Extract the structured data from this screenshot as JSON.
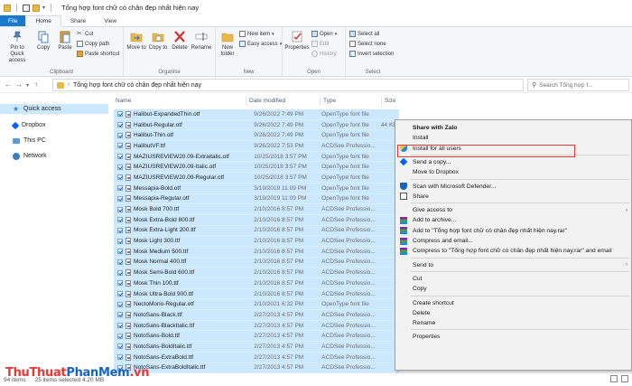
{
  "window": {
    "title": "Tổng hợp font chữ có chân đẹp nhất hiện nay"
  },
  "tabs": [
    {
      "label": "File"
    },
    {
      "label": "Home"
    },
    {
      "label": "Share"
    },
    {
      "label": "View"
    }
  ],
  "ribbon": {
    "clipboard": {
      "pin": "Pin to Quick access",
      "copy": "Copy",
      "paste": "Paste",
      "cut": "Cut",
      "copy_path": "Copy path",
      "paste_shortcut": "Paste shortcut",
      "label": "Clipboard"
    },
    "organise": {
      "move_to": "Move to",
      "copy_to": "Copy to",
      "delete": "Delete",
      "rename": "Rename",
      "label": "Organise"
    },
    "new": {
      "new_folder": "New folder",
      "new_item": "New item",
      "easy_access": "Easy access",
      "label": "New"
    },
    "open": {
      "properties": "Properties",
      "open": "Open",
      "edit": "Edit",
      "history": "History",
      "label": "Open"
    },
    "select": {
      "select_all": "Select all",
      "select_none": "Select none",
      "invert": "Invert selection",
      "label": "Select"
    }
  },
  "address": {
    "path": "Tổng hợp font chữ có chân đẹp nhất hiện nay",
    "search_placeholder": "Search Tổng hợp f..."
  },
  "nav_pane": [
    {
      "label": "Quick access",
      "icon": "star-icon"
    },
    {
      "label": "Dropbox",
      "icon": "dropbox-icon"
    },
    {
      "label": "This PC",
      "icon": "computer-icon"
    },
    {
      "label": "Network",
      "icon": "network-icon"
    }
  ],
  "columns": {
    "name": "Name",
    "date": "Date modified",
    "type": "Type",
    "size": "Size"
  },
  "files": [
    {
      "name": "Halibut-ExpandedThin.otf",
      "date": "9/26/2022 7:49 PM",
      "type": "OpenType font file",
      "size": ""
    },
    {
      "name": "Halibut-Regular.otf",
      "date": "9/26/2022 7:49 PM",
      "type": "OpenType font file",
      "size": "44 KB"
    },
    {
      "name": "Halibut-Thin.otf",
      "date": "9/26/2022 7:49 PM",
      "type": "OpenType font file",
      "size": ""
    },
    {
      "name": "HalibutVF.ttf",
      "date": "9/26/2022 7:53 PM",
      "type": "ACDSee Professio...",
      "size": ""
    },
    {
      "name": "MAZIUSREVIEW20.09-Extraitalic.otf",
      "date": "10/25/2018 3:57 PM",
      "type": "OpenType font file",
      "size": ""
    },
    {
      "name": "MAZIUSREVIEW20.09-Italic.otf",
      "date": "10/25/2018 3:57 PM",
      "type": "OpenType font file",
      "size": ""
    },
    {
      "name": "MAZIUSREVIEW20.09-Regular.otf",
      "date": "10/25/2018 3:57 PM",
      "type": "OpenType font file",
      "size": ""
    },
    {
      "name": "Messapia-Bold.otf",
      "date": "3/19/2019 11:09 PM",
      "type": "OpenType font file",
      "size": ""
    },
    {
      "name": "Messapia-Regular.otf",
      "date": "3/19/2019 11:09 PM",
      "type": "OpenType font file",
      "size": ""
    },
    {
      "name": "Mosk Bold 700.ttf",
      "date": "2/10/2016 8:57 PM",
      "type": "ACDSee Professio...",
      "size": ""
    },
    {
      "name": "Mosk Extra-Bold 800.ttf",
      "date": "2/10/2016 8:57 PM",
      "type": "ACDSee Professio...",
      "size": ""
    },
    {
      "name": "Mosk Extra-Light 200.ttf",
      "date": "2/10/2016 8:57 PM",
      "type": "ACDSee Professio...",
      "size": ""
    },
    {
      "name": "Mosk Light 300.ttf",
      "date": "2/10/2016 8:57 PM",
      "type": "ACDSee Professio...",
      "size": ""
    },
    {
      "name": "Mosk Medium 500.ttf",
      "date": "2/10/2016 8:57 PM",
      "type": "ACDSee Professio...",
      "size": ""
    },
    {
      "name": "Mosk Normal 400.ttf",
      "date": "2/10/2016 8:57 PM",
      "type": "ACDSee Professio...",
      "size": ""
    },
    {
      "name": "Mosk Semi-Bold 600.ttf",
      "date": "2/10/2016 8:57 PM",
      "type": "ACDSee Professio...",
      "size": ""
    },
    {
      "name": "Mosk Thin 100.ttf",
      "date": "2/10/2016 8:57 PM",
      "type": "ACDSee Professio...",
      "size": ""
    },
    {
      "name": "Mosk Ultra-Bold 900.ttf",
      "date": "2/10/2016 8:57 PM",
      "type": "ACDSee Professio...",
      "size": ""
    },
    {
      "name": "NectoMono-Regular.otf",
      "date": "2/10/2021 6:32 PM",
      "type": "OpenType font file",
      "size": ""
    },
    {
      "name": "NotoSans-Black.ttf",
      "date": "2/27/2013 4:57 PM",
      "type": "ACDSee Professio...",
      "size": ""
    },
    {
      "name": "NotoSans-BlackItalic.ttf",
      "date": "2/27/2013 4:57 PM",
      "type": "ACDSee Professio...",
      "size": ""
    },
    {
      "name": "NotoSans-Bold.ttf",
      "date": "2/27/2013 4:57 PM",
      "type": "ACDSee Professio...",
      "size": ""
    },
    {
      "name": "NotoSans-BoldItalic.ttf",
      "date": "2/27/2013 4:57 PM",
      "type": "ACDSee Professio...",
      "size": ""
    },
    {
      "name": "NotoSans-ExtraBold.ttf",
      "date": "2/27/2013 4:57 PM",
      "type": "ACDSee Professio...",
      "size": ""
    },
    {
      "name": "NotoSans-ExtraBoldItalic.ttf",
      "date": "2/27/2013 4:57 PM",
      "type": "ACDSee Professio...",
      "size": ""
    }
  ],
  "status": {
    "items": "94 items",
    "selected": "25 items selected  4.20 MB"
  },
  "context_menu": [
    {
      "label": "Share with Zalo",
      "bold": true,
      "icon": ""
    },
    {
      "label": "Install",
      "icon": ""
    },
    {
      "label": "Install for all users",
      "icon": "shield-icon"
    },
    {
      "sep": true
    },
    {
      "label": "Send a copy...",
      "icon": "dropbox-icon"
    },
    {
      "label": "Move to Dropbox",
      "icon": ""
    },
    {
      "sep": true
    },
    {
      "label": "Scan with Microsoft Defender...",
      "icon": "defender-icon"
    },
    {
      "label": "Share",
      "icon": "share-icon"
    },
    {
      "sep": true
    },
    {
      "label": "Give access to",
      "icon": "",
      "submenu": true
    },
    {
      "label": "Add to archive...",
      "icon": "winrar-icon"
    },
    {
      "label": "Add to \"Tổng hợp font chữ có chân đẹp nhất hiện nay.rar\"",
      "icon": "winrar-icon"
    },
    {
      "label": "Compress and email...",
      "icon": "winrar-icon"
    },
    {
      "label": "Compress to \"Tổng hợp font chữ có chân đẹp nhất hiện nay.rar\" and email",
      "icon": "winrar-icon"
    },
    {
      "sep": true
    },
    {
      "label": "Send to",
      "icon": "",
      "submenu": true
    },
    {
      "sep": true
    },
    {
      "label": "Cut",
      "icon": ""
    },
    {
      "label": "Copy",
      "icon": ""
    },
    {
      "sep": true
    },
    {
      "label": "Create shortcut",
      "icon": ""
    },
    {
      "label": "Delete",
      "icon": ""
    },
    {
      "label": "Rename",
      "icon": ""
    },
    {
      "sep": true
    },
    {
      "label": "Properties",
      "icon": ""
    }
  ],
  "watermark": {
    "part1": "Thu",
    "part2": "Thuat",
    "part3": "PhanMem",
    "part4": ".vn"
  },
  "colors": {
    "accent": "#1979ca",
    "selection": "#cce8ff",
    "highlight_box": "#e53935",
    "folder": "#e8b84a"
  }
}
